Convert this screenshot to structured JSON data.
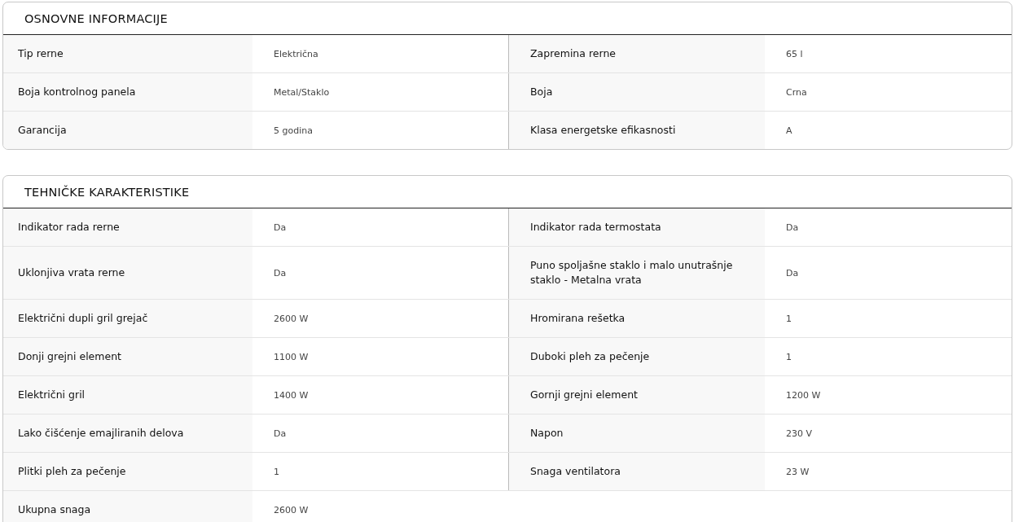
{
  "sections": [
    {
      "title": "OSNOVNE INFORMACIJE",
      "rows": [
        [
          {
            "label": "Tip rerne",
            "value": "Električna"
          },
          {
            "label": "Zapremina rerne",
            "value": "65 l"
          }
        ],
        [
          {
            "label": "Boja kontrolnog panela",
            "value": "Metal/Staklo"
          },
          {
            "label": "Boja",
            "value": "Crna"
          }
        ],
        [
          {
            "label": "Garancija",
            "value": "5 godina"
          },
          {
            "label": "Klasa energetske efikasnosti",
            "value": "A"
          }
        ]
      ]
    },
    {
      "title": "TEHNIČKE KARAKTERISTIKE",
      "rows": [
        [
          {
            "label": "Indikator rada rerne",
            "value": "Da"
          },
          {
            "label": "Indikator rada termostata",
            "value": "Da"
          }
        ],
        [
          {
            "label": "Uklonjiva vrata rerne",
            "value": "Da"
          },
          {
            "label": "Puno spoljašne staklo i malo unutrašnje staklo - Metalna vrata",
            "value": "Da"
          }
        ],
        [
          {
            "label": "Električni dupli gril grejač",
            "value": "2600 W"
          },
          {
            "label": "Hromirana rešetka",
            "value": "1"
          }
        ],
        [
          {
            "label": "Donji grejni element",
            "value": "1100 W"
          },
          {
            "label": "Duboki pleh za pečenje",
            "value": "1"
          }
        ],
        [
          {
            "label": "Električni gril",
            "value": "1400 W"
          },
          {
            "label": "Gornji grejni element",
            "value": "1200 W"
          }
        ],
        [
          {
            "label": "Lako čišćenje emajliranih delova",
            "value": "Da"
          },
          {
            "label": "Napon",
            "value": "230 V"
          }
        ],
        [
          {
            "label": "Plitki pleh za pečenje",
            "value": "1"
          },
          {
            "label": "Snaga ventilatora",
            "value": "23 W"
          }
        ],
        [
          {
            "label": "Ukupna snaga",
            "value": "2600 W"
          }
        ]
      ]
    }
  ]
}
